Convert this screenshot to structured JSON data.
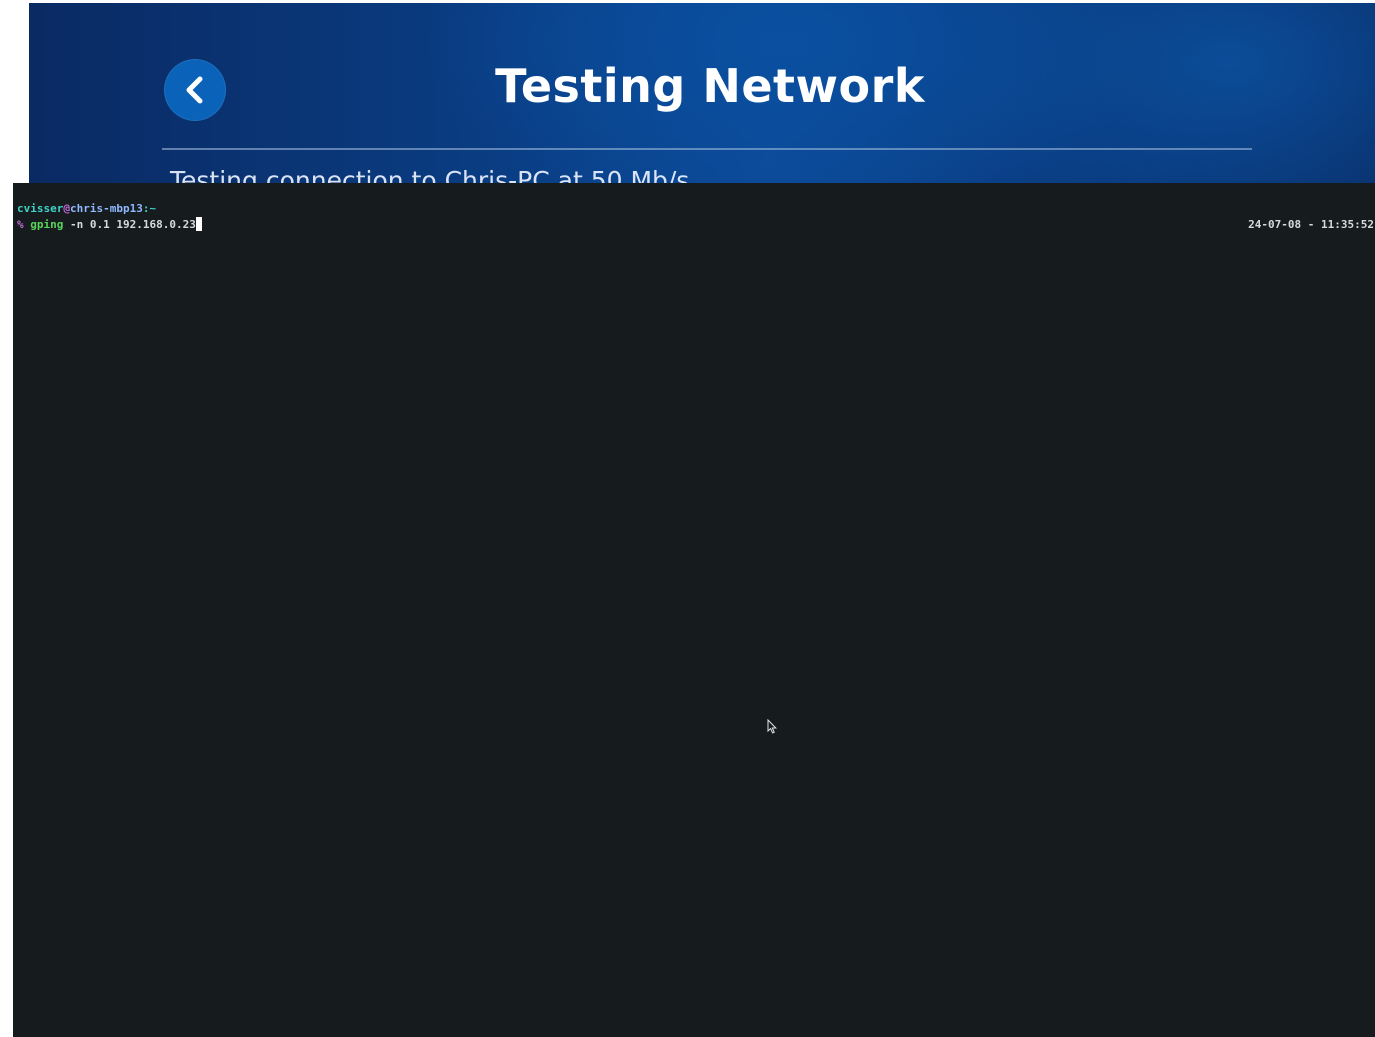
{
  "background_app": {
    "title": "Testing Network",
    "subtitle": "Testing connection to Chris-PC at 50 Mb/s",
    "back_icon": "chevron-left-icon",
    "colors": {
      "background": "#0a3d83",
      "back_button": "#0a63b8"
    }
  },
  "terminal": {
    "prompt": {
      "user": "cvisser",
      "at": "@",
      "host": "chris-mbp13",
      "path_separator": ":~",
      "symbol": "%"
    },
    "command": {
      "program": "gping",
      "arguments": " -n 0.1 192.168.0.23"
    },
    "right_prompt": "24-07-08 - 11:35:52",
    "colors": {
      "background": "#161b1e",
      "user": "#3fd3c7",
      "at": "#c36ad9",
      "host": "#8fb8ff",
      "command": "#59d45a"
    }
  }
}
